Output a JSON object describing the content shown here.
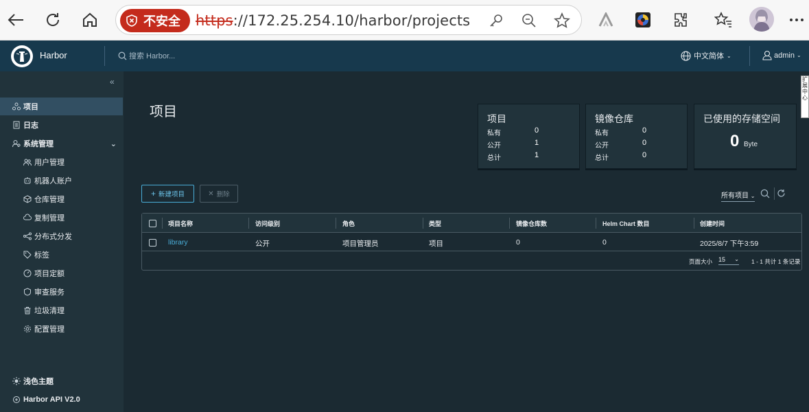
{
  "browser": {
    "security_label": "不安全",
    "url_protocol": "https",
    "url_rest": "://172.25.254.10/harbor/projects"
  },
  "header": {
    "brand": "Harbor",
    "search_placeholder": "搜索 Harbor...",
    "language": "中文简体",
    "user": "admin"
  },
  "sidebar": {
    "items": [
      {
        "label": "项目",
        "icon": "projects-icon"
      },
      {
        "label": "日志",
        "icon": "logs-icon"
      },
      {
        "label": "系统管理",
        "icon": "admin-icon"
      },
      {
        "label": "用户管理",
        "icon": "users-icon"
      },
      {
        "label": "机器人账户",
        "icon": "robot-icon"
      },
      {
        "label": "仓库管理",
        "icon": "registry-icon"
      },
      {
        "label": "复制管理",
        "icon": "replication-icon"
      },
      {
        "label": "分布式分发",
        "icon": "distribution-icon"
      },
      {
        "label": "标签",
        "icon": "tag-icon"
      },
      {
        "label": "项目定额",
        "icon": "quota-icon"
      },
      {
        "label": "审查服务",
        "icon": "scanner-icon"
      },
      {
        "label": "垃圾清理",
        "icon": "trash-icon"
      },
      {
        "label": "配置管理",
        "icon": "gear-icon"
      }
    ],
    "theme_label": "浅色主题",
    "api_label": "Harbor API V2.0"
  },
  "main": {
    "title": "项目",
    "cards": {
      "projects": {
        "title": "项目",
        "private_label": "私有",
        "private": "0",
        "public_label": "公开",
        "public": "1",
        "total_label": "总计",
        "total": "1"
      },
      "repos": {
        "title": "镜像仓库",
        "private_label": "私有",
        "private": "0",
        "public_label": "公开",
        "public": "0",
        "total_label": "总计",
        "total": "0"
      },
      "storage": {
        "title": "已使用的存储空间",
        "value": "0",
        "unit": "Byte"
      }
    },
    "new_project": "新建项目",
    "delete": "删除",
    "filter": "所有项目",
    "table": {
      "headers": [
        "项目名称",
        "访问级别",
        "角色",
        "类型",
        "镜像仓库数",
        "Helm Chart 数目",
        "创建时间"
      ],
      "rows": [
        {
          "name": "library",
          "access": "公开",
          "role": "项目管理员",
          "type": "项目",
          "repos": "0",
          "charts": "0",
          "created": "2025/8/7 下午3:59"
        }
      ],
      "page_size_label": "页面大小",
      "page_size": "15",
      "summary": "1 - 1 共计 1 条记录"
    }
  },
  "side_tab": "扩\n展\n中\n心"
}
